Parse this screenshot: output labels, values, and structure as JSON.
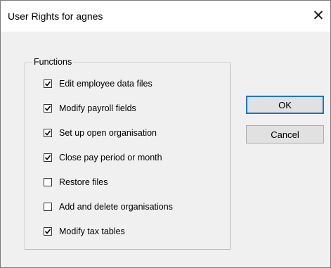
{
  "window": {
    "title": "User Rights for agnes",
    "close_glyph": "✕"
  },
  "group": {
    "legend": "Functions",
    "items": [
      {
        "label": "Edit employee data files",
        "checked": true
      },
      {
        "label": "Modify payroll fields",
        "checked": true
      },
      {
        "label": "Set up open organisation",
        "checked": true
      },
      {
        "label": "Close pay period or month",
        "checked": true
      },
      {
        "label": "Restore files",
        "checked": false
      },
      {
        "label": "Add and delete organisations",
        "checked": false
      },
      {
        "label": "Modify tax tables",
        "checked": true
      }
    ]
  },
  "buttons": {
    "ok_label": "OK",
    "cancel_label": "Cancel"
  }
}
